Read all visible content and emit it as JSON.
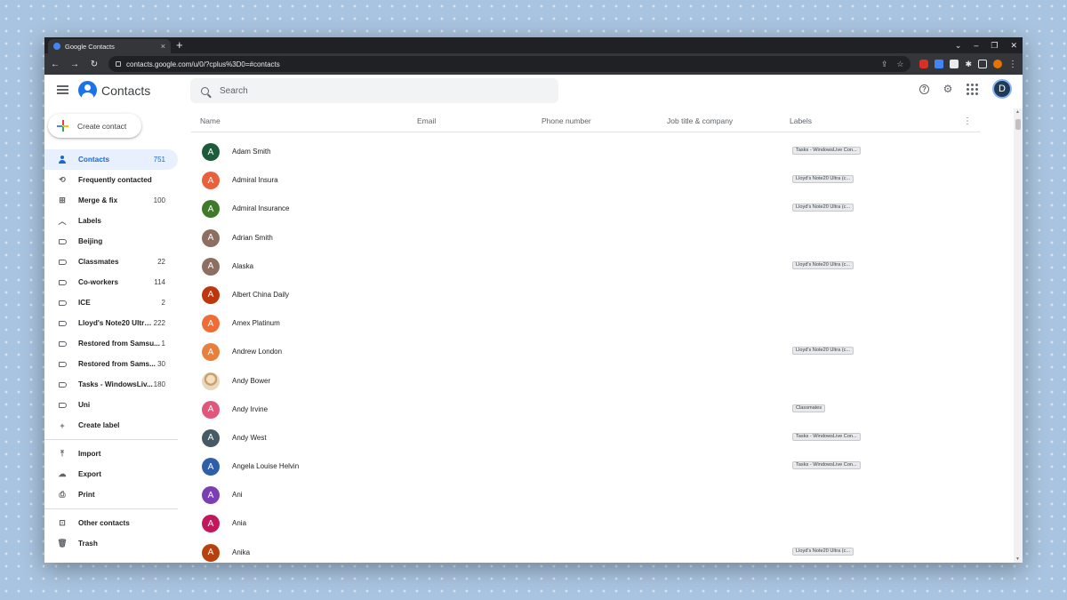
{
  "browser": {
    "tab_title": "Google Contacts",
    "tab_close": "×",
    "new_tab": "+",
    "url": "contacts.google.com/u/0/?cplus%3D0=#contacts",
    "window_controls": [
      "⌄",
      "–",
      "❐",
      "✕"
    ]
  },
  "app": {
    "title": "Contacts",
    "search_placeholder": "Search",
    "user_initial": "D",
    "accent_color": "#1a73e8"
  },
  "sidebar": {
    "create_label": "Create contact",
    "primary": [
      {
        "label": "Contacts",
        "count": "751",
        "icon": "person-icon",
        "active": true
      },
      {
        "label": "Frequently contacted",
        "count": "",
        "icon": "history-icon"
      },
      {
        "label": "Merge & fix",
        "count": "100",
        "icon": "merge-icon"
      }
    ],
    "labels_header": "Labels",
    "labels": [
      {
        "label": "Beijing",
        "count": ""
      },
      {
        "label": "Classmates",
        "count": "22"
      },
      {
        "label": "Co-workers",
        "count": "114"
      },
      {
        "label": "ICE",
        "count": "2"
      },
      {
        "label": "Lloyd's Note20 Ultra...",
        "count": "222"
      },
      {
        "label": "Restored from Samsu...",
        "count": "1"
      },
      {
        "label": "Restored from Sams...",
        "count": "30"
      },
      {
        "label": "Tasks - WindowsLiv...",
        "count": "180"
      },
      {
        "label": "Uni",
        "count": ""
      }
    ],
    "create_label_text": "Create label",
    "tools": [
      {
        "label": "Import",
        "icon": "import-icon"
      },
      {
        "label": "Export",
        "icon": "cloud-export-icon"
      },
      {
        "label": "Print",
        "icon": "printer-icon"
      }
    ],
    "other": [
      {
        "label": "Other contacts",
        "icon": "other-contacts-icon"
      },
      {
        "label": "Trash",
        "icon": "trash-icon"
      }
    ]
  },
  "table": {
    "headers": [
      "Name",
      "Email",
      "Phone number",
      "Job title & company",
      "Labels"
    ],
    "rows": [
      {
        "initial": "A",
        "name": "Adam Smith",
        "color": "#1e5b3a",
        "label": "Tasks - WindowsLive Con..."
      },
      {
        "initial": "A",
        "name": "Admiral Insura",
        "color": "#e8603c",
        "label": "Lloyd's Note20 Ultra (c..."
      },
      {
        "initial": "A",
        "name": "Admiral Insurance",
        "color": "#3f7a2b",
        "label": "Lloyd's Note20 Ultra (c..."
      },
      {
        "initial": "A",
        "name": "Adrian Smith",
        "color": "#8d6e63",
        "label": ""
      },
      {
        "initial": "A",
        "name": "Alaska",
        "color": "#8d6e63",
        "label": "Lloyd's Note20 Ultra (c..."
      },
      {
        "initial": "A",
        "name": "Albert China Daily",
        "color": "#bf360c",
        "label": ""
      },
      {
        "initial": "A",
        "name": "Amex Platinum",
        "color": "#ef6c35",
        "label": ""
      },
      {
        "initial": "A",
        "name": "Andrew London",
        "color": "#e8803c",
        "label": "Lloyd's Note20 Ultra (c..."
      },
      {
        "initial": "",
        "name": "Andy Bower",
        "color": "",
        "label": "",
        "photo": true
      },
      {
        "initial": "A",
        "name": "Andy Irvine",
        "color": "#e0577a",
        "label": "Classmates"
      },
      {
        "initial": "A",
        "name": "Andy West",
        "color": "#455a64",
        "label": "Tasks - WindowsLive Con..."
      },
      {
        "initial": "A",
        "name": "Angela Louise Helvin",
        "color": "#2f5fa8",
        "label": "Tasks - WindowsLive Con..."
      },
      {
        "initial": "A",
        "name": "Ani",
        "color": "#7b3fb5",
        "label": ""
      },
      {
        "initial": "A",
        "name": "Ania",
        "color": "#c2185b",
        "label": ""
      },
      {
        "initial": "A",
        "name": "Anika",
        "color": "#b7410e",
        "label": "Lloyd's Note20 Ultra (c..."
      }
    ]
  }
}
